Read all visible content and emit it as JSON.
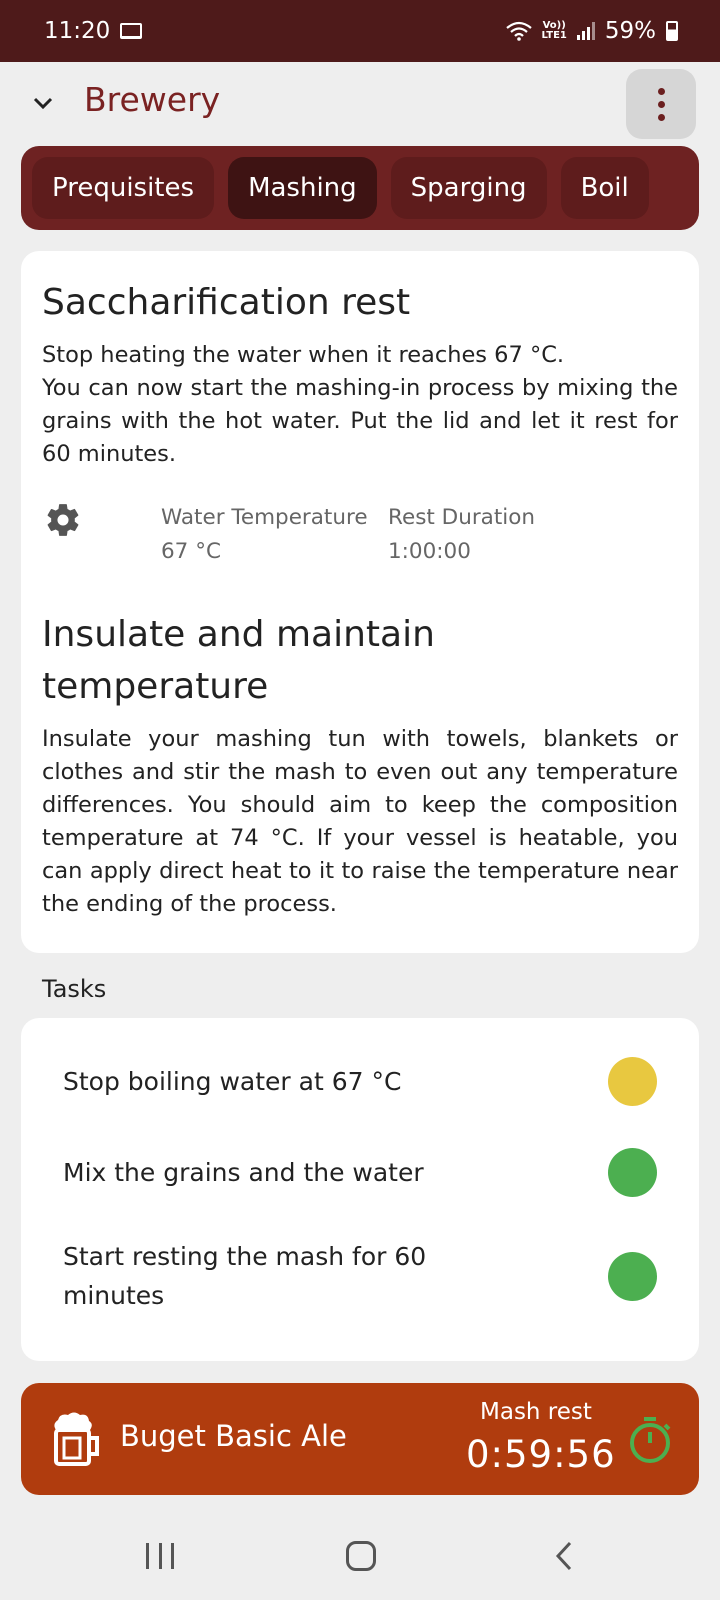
{
  "status_bar": {
    "time": "11:20",
    "battery": "59%",
    "network": "Vo)) LTE1"
  },
  "app_bar": {
    "title": "Brewery"
  },
  "tabs": [
    {
      "label": "Prequisites",
      "active": false
    },
    {
      "label": "Mashing",
      "active": true
    },
    {
      "label": "Sparging",
      "active": false
    },
    {
      "label": "Boil",
      "active": false
    }
  ],
  "steps": [
    {
      "title": "Saccharification rest",
      "body": "Stop heating the water when it reaches 67 °C.\nYou can now start the mashing-in process by mixing the grains with the hot water. Put the lid and let it rest for 60 minutes.",
      "params": [
        {
          "label": "Water Temperature",
          "value": "67 °C"
        },
        {
          "label": "Rest Duration",
          "value": "1:00:00"
        }
      ]
    },
    {
      "title": "Insulate and maintain temperature",
      "body": "Insulate your mashing tun with towels, blankets or clothes and stir the mash to even out any temperature differences. You should aim to keep the composition temperature at 74 °C. If your vessel is heatable, you can apply direct heat to it to raise the temperature near the ending of the process."
    }
  ],
  "tasks": {
    "heading": "Tasks",
    "items": [
      {
        "label": "Stop boiling water at 67 °C",
        "status_color": "#e8c840"
      },
      {
        "label": "Mix the grains and the water",
        "status_color": "#4caf50"
      },
      {
        "label": "Start resting the mash for 60 minutes",
        "status_color": "#4caf50"
      }
    ]
  },
  "brew_banner": {
    "name": "Buget Basic Ale",
    "timer_label": "Mash rest",
    "timer_value": "0:59:56",
    "timer_icon_color": "#4caf50"
  },
  "colors": {
    "status_bar": "#4e1a1a",
    "accent": "#7a2222",
    "tab_bar": "#6e2222",
    "banner": "#b03c0e"
  },
  "icons": [
    "laptop-icon",
    "wifi-icon",
    "signal-icon",
    "battery-icon",
    "chevron-down-icon",
    "more-vert-icon",
    "gear-icon",
    "beer-mug-icon",
    "stopwatch-icon"
  ]
}
